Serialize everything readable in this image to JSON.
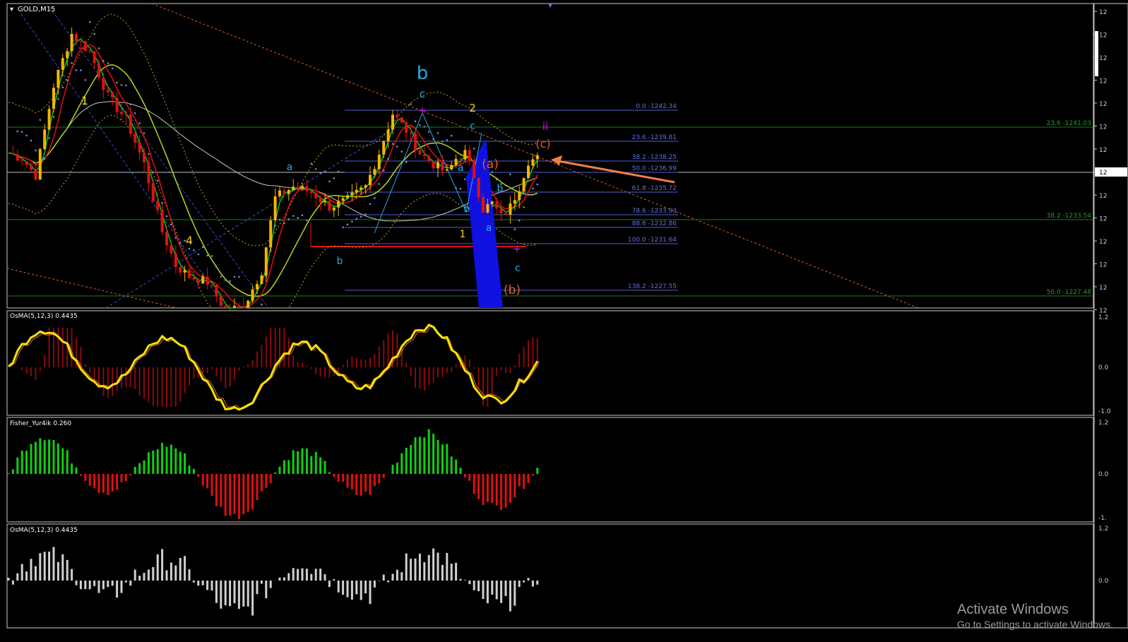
{
  "main_panel": {
    "title": "GOLD,M15",
    "fib_levels": [
      {
        "label": "0.0 -1242.34",
        "price": 1242.34
      },
      {
        "label": "23.6 -1239.81",
        "price": 1239.81
      },
      {
        "label": "38.2 -1238.25",
        "price": 1238.25
      },
      {
        "label": "50.0 -1236.99",
        "price": 1236.99
      },
      {
        "label": "61.8 -1235.72",
        "price": 1235.72
      },
      {
        "label": "78.6 -1233.93",
        "price": 1233.93
      },
      {
        "label": "88.6 -1232.86",
        "price": 1232.86
      },
      {
        "label": "100.0 -1231.64",
        "price": 1231.64
      },
      {
        "label": "138.2 -1227.55",
        "price": 1227.55
      }
    ],
    "green_fib_levels": [
      {
        "label": "23.6 -1241.03",
        "price": 1241.03
      },
      {
        "label": "38.2 -1233.54",
        "price": 1233.54
      },
      {
        "label": "50.0 -1227.48",
        "price": 1227.48
      }
    ],
    "wave_labels": [
      {
        "text": "b",
        "color": "#29a9e8",
        "size": "big"
      },
      {
        "text": "c",
        "color": "#29a9e8"
      },
      {
        "text": "2",
        "color": "#f2d21f"
      },
      {
        "text": "c",
        "color": "#29a9e8"
      },
      {
        "text": "ii",
        "color": "#c020d0"
      },
      {
        "text": "(c)",
        "color": "#e06020"
      },
      {
        "text": "a",
        "color": "#29a9e8"
      },
      {
        "text": "a",
        "color": "#29a9e8"
      },
      {
        "text": "(a)",
        "color": "#e06020"
      },
      {
        "text": "b",
        "color": "#29a9e8"
      },
      {
        "text": "b",
        "color": "#29a9e8"
      },
      {
        "text": "a",
        "color": "#29a9e8"
      },
      {
        "text": "1",
        "color": "#f2d21f"
      },
      {
        "text": "b",
        "color": "#29a9e8"
      },
      {
        "text": "c",
        "color": "#29a9e8"
      },
      {
        "text": "(b)",
        "color": "#e06020"
      },
      {
        "text": "1",
        "color": "#f2d21f"
      },
      {
        "text": "4",
        "color": "#f2d21f"
      }
    ],
    "axis_ticks": [
      "12",
      "12",
      "12",
      "12",
      "12",
      "12",
      "12",
      "12",
      "12",
      "12",
      "12",
      "12",
      "12",
      "12"
    ],
    "current_price_label": "12"
  },
  "osma_panel": {
    "title": "OsMA(5,12,3) 0.4435",
    "ticks": [
      "1.2",
      "0.0",
      "-1.0"
    ]
  },
  "fisher_panel": {
    "title": "Fisher_Yur4ik 0.260",
    "ticks": [
      "1.2",
      "0.0",
      "-1."
    ]
  },
  "osma2_panel": {
    "title": "OsMA(5,12,3) 0.4435",
    "ticks": [
      "1.2",
      "0.0"
    ]
  },
  "colors": {
    "bull": "#f4b400",
    "bear": "#e01010",
    "fib": "#5060d0",
    "green_fib": "#1e7a1e",
    "ma_red": "#e01010",
    "ma_green": "#10c010",
    "ma_lime": "#b8d820",
    "ma_white": "#c8c8b0",
    "osma_yellow": "#ffe000",
    "fisher_green": "#10d010",
    "fisher_red": "#e01010"
  },
  "watermark": {
    "line1": "Activate Windows",
    "line2": "Go to Settings to activate Windows."
  }
}
